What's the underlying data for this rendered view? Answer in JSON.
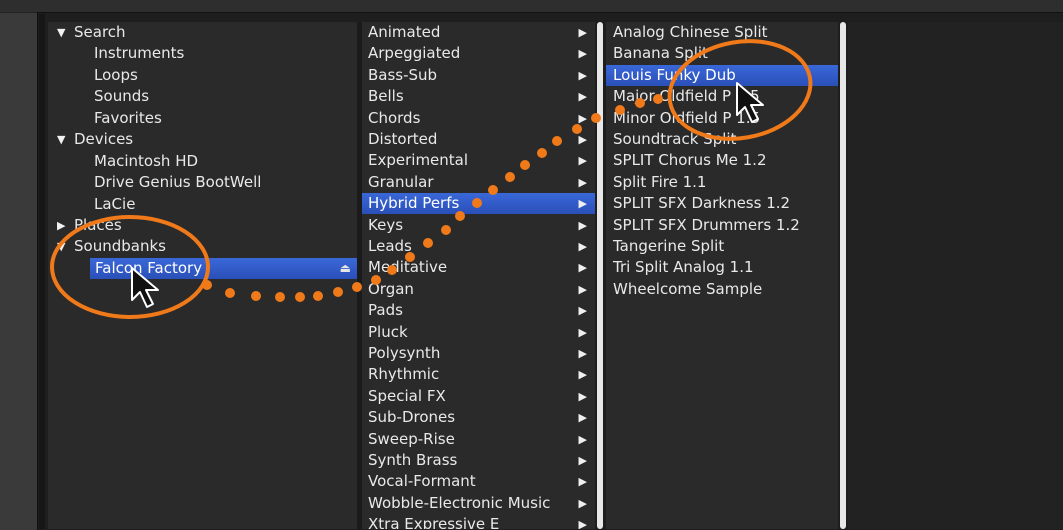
{
  "sidebar": {
    "sections": [
      {
        "label": "Search",
        "expanded": true,
        "items": [
          "Instruments",
          "Loops",
          "Sounds",
          "Favorites"
        ]
      },
      {
        "label": "Devices",
        "expanded": true,
        "items": [
          "Macintosh HD",
          "Drive Genius BootWell",
          "LaCie"
        ]
      },
      {
        "label": "Places",
        "expanded": false,
        "items": []
      },
      {
        "label": "Soundbanks",
        "expanded": true,
        "items": [
          "Falcon Factory"
        ]
      }
    ],
    "selected_item": "Falcon Factory",
    "eject_glyph": "⏏"
  },
  "categories": {
    "items": [
      "Animated",
      "Arpeggiated",
      "Bass-Sub",
      "Bells",
      "Chords",
      "Distorted",
      "Experimental",
      "Granular",
      "Hybrid Perfs",
      "Keys",
      "Leads",
      "Meditative",
      "Organ",
      "Pads",
      "Pluck",
      "Polysynth",
      "Rhythmic",
      "Special FX",
      "Sub-Drones",
      "Sweep-Rise",
      "Synth Brass",
      "Vocal-Formant",
      "Wobble-Electronic Music",
      "Xtra Expressive E"
    ],
    "selected": "Hybrid Perfs",
    "arrow_glyph": "▶"
  },
  "presets": {
    "items": [
      "Analog Chinese Split",
      "Banana Split",
      "Louis Funky Dub",
      "Major Oldfield P 1.5",
      "Minor Oldfield P 1.5",
      "Soundtrack Split",
      "SPLIT Chorus Me 1.2",
      "Split Fire 1.1",
      "SPLIT SFX Darkness 1.2",
      "SPLIT SFX Drummers 1.2",
      "Tangerine Split",
      "Tri Split Analog 1.1",
      "Wheelcome Sample"
    ],
    "selected": "Louis Funky Dub"
  },
  "colors": {
    "highlight": "#2f5ac6",
    "annotation": "#f07a1a",
    "panel": "#2a2a2a"
  }
}
